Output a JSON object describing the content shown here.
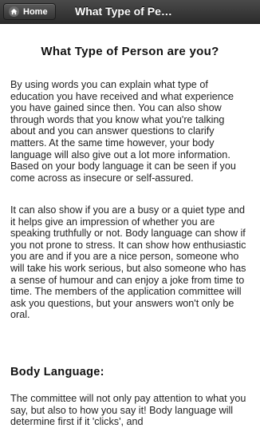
{
  "header": {
    "home_label": "Home",
    "title": "What Type of Pe…"
  },
  "article": {
    "heading": "What Type of Person are you?",
    "paragraph_1": "By using words you can explain what type of education you have received and what experience you have gained since then. You can also show through words that you know what you're talking about and you can answer questions to clarify matters. At the same time however, your body language will also give out a lot more information. Based on your body language it can be seen if you come across as insecure or self-assured.",
    "paragraph_2": "It can also show if you are a busy or a quiet type and it helps give an impression of whether you are speaking truthfully or not. Body language can show if you not prone to stress. It can show how enthusiastic you are and if you are a nice person, someone who will take his work serious, but also someone who has a sense of humour and can enjoy a joke from time to time. The members of the application committee will ask you questions, but your answers won't only be oral.",
    "subheading": "Body Language:",
    "paragraph_3": "The committee will not only pay attention to what you say, but also to how you say it! Body language will determine first if it 'clicks', and"
  }
}
